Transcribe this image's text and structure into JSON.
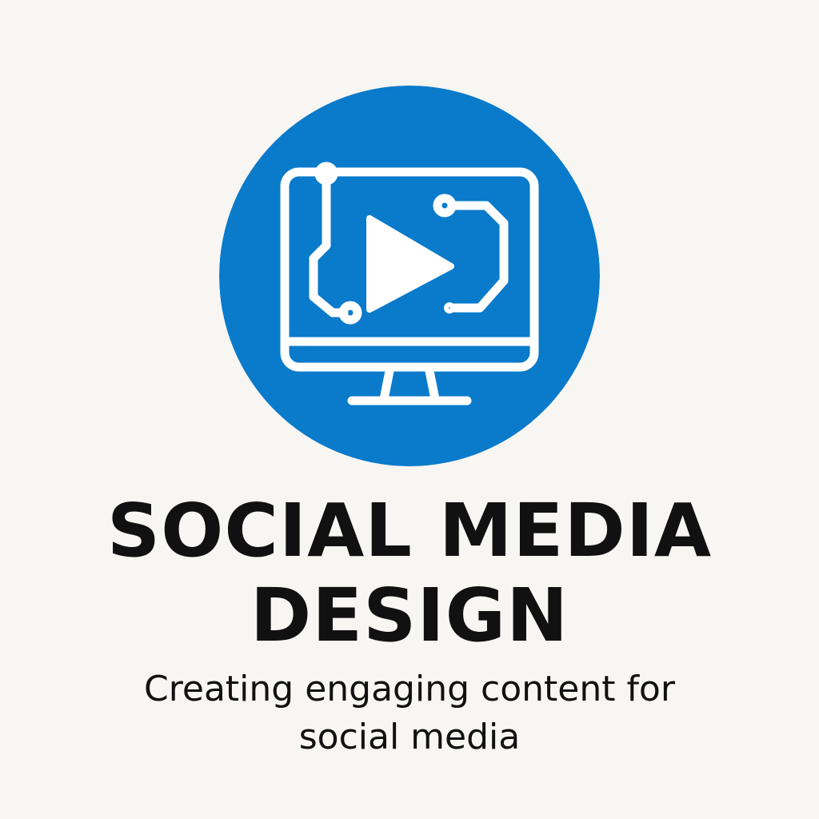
{
  "colors": {
    "background": "#F7F6F3",
    "circle": "#0A7ACB",
    "icon_stroke": "#FFFFFF",
    "text": "#111111"
  },
  "logo": {
    "icon": "monitor-play-circuit-icon"
  },
  "title": {
    "line1": "SOCIAL MEDIA",
    "line2": "DESIGN"
  },
  "subtitle": {
    "line1": "Creating engaging content for",
    "line2": "social media"
  }
}
